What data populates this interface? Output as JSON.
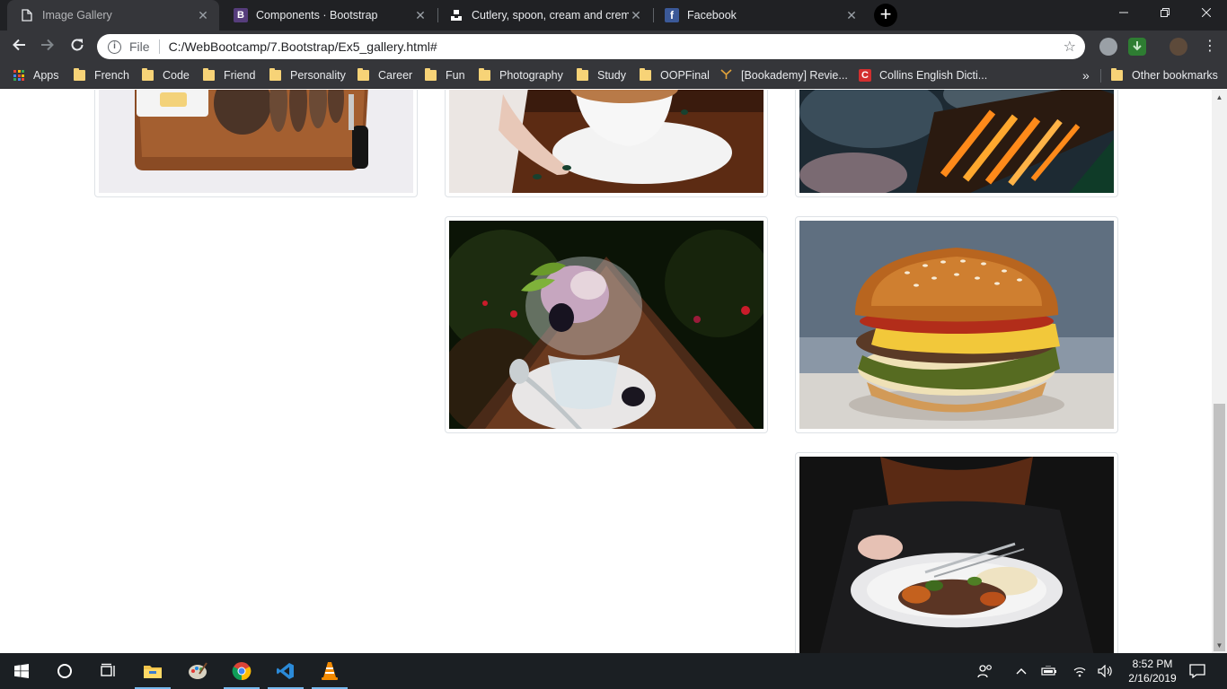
{
  "browser": {
    "tabs": [
      {
        "title": "Image Gallery",
        "icon": "document-icon",
        "active": true
      },
      {
        "title": "Components · Bootstrap",
        "icon": "bootstrap-icon",
        "favicon_letter": "B",
        "active": false
      },
      {
        "title": "Cutlery, spoon, cream and creme",
        "icon": "unsplash-icon",
        "active": false
      },
      {
        "title": "Facebook",
        "icon": "facebook-icon",
        "favicon_letter": "f",
        "active": false
      }
    ],
    "new_tab_label": "+",
    "address": {
      "scheme_label": "File",
      "url": "C:/WebBootcamp/7.Bootstrap/Ex5_gallery.html#"
    },
    "bookmarks": [
      {
        "label": "Apps",
        "icon": "apps-grid-icon"
      },
      {
        "label": "French",
        "icon": "folder-icon"
      },
      {
        "label": "Code",
        "icon": "folder-icon"
      },
      {
        "label": "Friend",
        "icon": "folder-icon"
      },
      {
        "label": "Personality",
        "icon": "folder-icon"
      },
      {
        "label": "Career",
        "icon": "folder-icon"
      },
      {
        "label": "Fun",
        "icon": "folder-icon"
      },
      {
        "label": "Photography",
        "icon": "folder-icon"
      },
      {
        "label": "Study",
        "icon": "folder-icon"
      },
      {
        "label": "OOPFinal",
        "icon": "folder-icon"
      },
      {
        "label": "[Bookademy] Revie...",
        "icon": "bookademy-icon"
      },
      {
        "label": "Collins English Dicti...",
        "icon": "collins-icon"
      }
    ],
    "overflow_label": "»",
    "other_bookmarks": "Other bookmarks"
  },
  "gallery": {
    "images": [
      {
        "subject": "bread-board",
        "icon": "photo-bread-icon"
      },
      {
        "subject": "coffee-cup",
        "icon": "photo-coffee-icon"
      },
      {
        "subject": "grill-fire",
        "icon": "photo-grill-icon"
      },
      {
        "subject": "ice-cream-blackberries",
        "icon": "photo-icecream-icon"
      },
      {
        "subject": "cheeseburger",
        "icon": "photo-burger-icon"
      },
      {
        "subject": "plated-dish",
        "icon": "photo-dish-icon"
      }
    ]
  },
  "taskbar": {
    "time": "8:52 PM",
    "date": "2/16/2019",
    "apps": [
      "windows-start-icon",
      "cortana-icon",
      "task-view-icon",
      "file-explorer-icon",
      "paint-icon",
      "chrome-icon",
      "vscode-icon",
      "vlc-icon"
    ]
  },
  "colors": {
    "tab_strip": "#202124",
    "toolbar": "#35363a",
    "thumbnail_border": "#dee2e6",
    "taskbar": "#1b1f23"
  }
}
